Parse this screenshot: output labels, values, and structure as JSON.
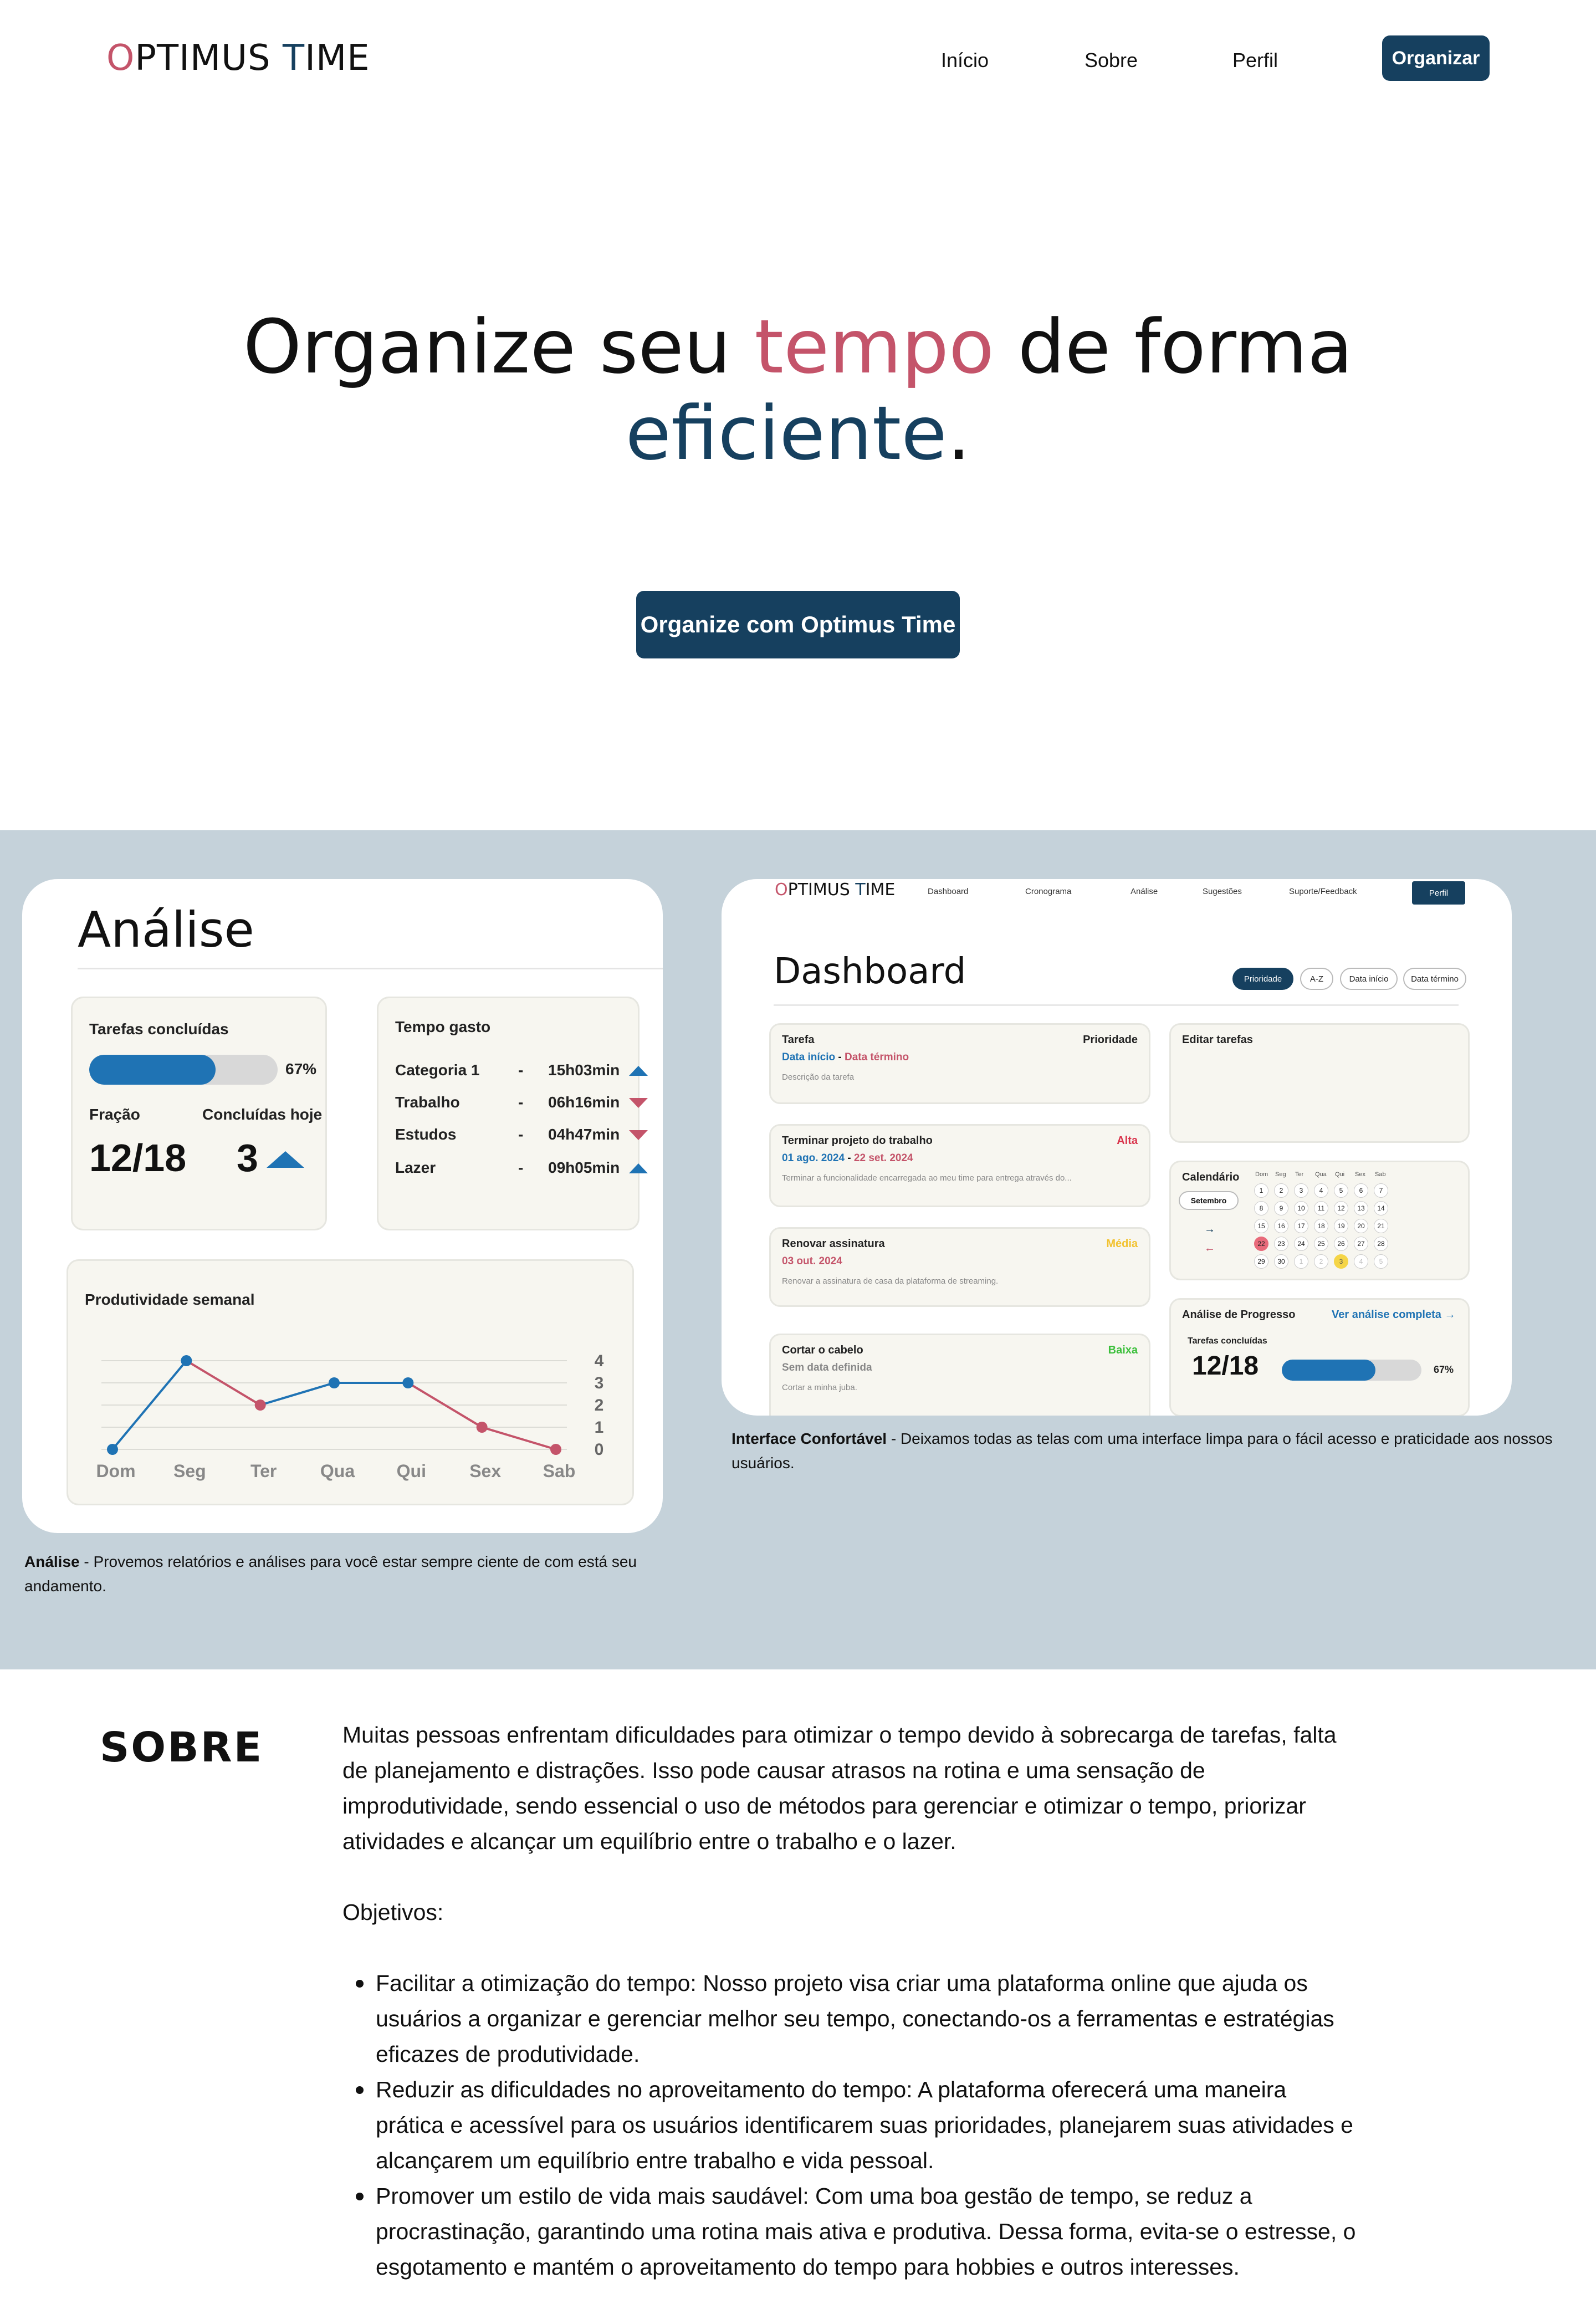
{
  "nav": {
    "logo_o": "O",
    "logo_ptimus": "PTIMUS ",
    "logo_t": "T",
    "logo_ime": "IME",
    "links": [
      "Início",
      "Sobre",
      "Perfil"
    ],
    "cta": "Organizar"
  },
  "hero": {
    "title_1": "Organize seu ",
    "title_pink": "tempo",
    "title_2": " de forma",
    "title_navy": "eficiente",
    "title_dot": ".",
    "cta": "Organize com Optimus Time"
  },
  "analysis": {
    "title": "Análise",
    "tasks_title": "Tarefas concluídas",
    "progress_label": "67%",
    "progress_value": 0.67,
    "fraction_label": "Fração",
    "fraction_value": "12/18",
    "done_today_label": "Concluídas hoje",
    "done_today_value": "3",
    "time_title": "Tempo gasto",
    "time_rows": [
      {
        "category": "Categoria 1",
        "dash": "-",
        "value": "15h03min",
        "trend": "up"
      },
      {
        "category": "Trabalho",
        "dash": "-",
        "value": "06h16min",
        "trend": "down"
      },
      {
        "category": "Estudos",
        "dash": "-",
        "value": "04h47min",
        "trend": "down"
      },
      {
        "category": "Lazer",
        "dash": "-",
        "value": "09h05min",
        "trend": "up"
      }
    ],
    "caption_bold": "Análise",
    "caption_text": " - Provemos relatórios e análises para você estar sempre ciente de com está seu andamento."
  },
  "chart_data": {
    "type": "line",
    "title": "Produtividade semanal",
    "categories": [
      "Dom",
      "Seg",
      "Ter",
      "Qua",
      "Qui",
      "Sex",
      "Sab"
    ],
    "values": [
      0,
      4,
      2,
      3,
      3,
      1,
      0
    ],
    "yticks": [
      "4",
      "3",
      "2",
      "1",
      "0"
    ],
    "ylim": [
      0,
      4
    ],
    "colors": {
      "rise": "#1f73b4",
      "fall": "#c4546a"
    },
    "grid": true
  },
  "dashboard": {
    "logo_o": "O",
    "logo_ptimus": "PTIMUS ",
    "logo_t": "T",
    "logo_ime": "IME",
    "nav": [
      "Dashboard",
      "Cronograma",
      "Análise",
      "Sugestões",
      "Suporte/Feedback"
    ],
    "perfil": "Perfil",
    "title": "Dashboard",
    "filters": [
      "Prioridade",
      "A-Z",
      "Data início",
      "Data término"
    ],
    "tasks": [
      {
        "title": "Tarefa",
        "priority": "Prioridade",
        "date_start": "Data início",
        "sep": " - ",
        "date_end": "Data término",
        "desc": "Descrição da tarefa"
      },
      {
        "title": "Terminar projeto do trabalho",
        "priority": "Alta",
        "date_start": "01 ago. 2024",
        "sep": " - ",
        "date_end": "22 set. 2024",
        "desc": "Terminar a funcionalidade encarregada ao meu time para entrega através do..."
      },
      {
        "title": "Renovar assinatura",
        "priority": "Média",
        "date_start": "03 out. 2024",
        "sep": "",
        "date_end": "",
        "desc": "Renovar a assinatura de casa da plataforma de streaming."
      },
      {
        "title": "Cortar o cabelo",
        "priority": "Baixa",
        "date_start": "Sem data definida",
        "sep": "",
        "date_end": "",
        "desc": "Cortar a minha juba."
      }
    ],
    "edit_tasks": "Editar tarefas",
    "calendar_title": "Calendário",
    "calendar_month": "Setembro",
    "calendar_weekdays": [
      "Dom",
      "Seg",
      "Ter",
      "Qua",
      "Qui",
      "Sex",
      "Sab"
    ],
    "calendar_days": [
      "1",
      "2",
      "3",
      "4",
      "5",
      "6",
      "7",
      "8",
      "9",
      "10",
      "11",
      "12",
      "13",
      "14",
      "15",
      "16",
      "17",
      "18",
      "19",
      "20",
      "21",
      "22",
      "23",
      "24",
      "25",
      "26",
      "27",
      "28",
      "29",
      "30",
      "1",
      "2",
      "3",
      "4",
      "5"
    ],
    "calendar_prev": "→",
    "calendar_next": "←",
    "progress_title": "Análise de Progresso",
    "progress_link": "Ver análise completa →",
    "progress_sub": "Tarefas concluídas",
    "progress_fraction": "12/18",
    "progress_pct": "67%",
    "progress_value": 0.67,
    "caption_bold": "Interface Confortável",
    "caption_text": " - Deixamos todas as telas com uma interface limpa para o fácil acesso e praticidade aos nossos usuários."
  },
  "sobre": {
    "heading": "SOBRE",
    "intro": "Muitas pessoas enfrentam dificuldades para otimizar o tempo devido à sobrecarga de tarefas, falta de planejamento e distrações. Isso pode causar atrasos na rotina e uma sensação de improdutividade, sendo essencial o uso de métodos para gerenciar e otimizar o tempo, priorizar atividades e alcançar um equilíbrio entre o trabalho e o lazer.",
    "objectives_label": "Objetivos:",
    "objectives": [
      "Facilitar a otimização do tempo: Nosso projeto visa criar uma plataforma online que ajuda os usuários a  organizar e gerenciar melhor seu tempo, conectando-os a ferramentas e estratégias eficazes de produtividade.",
      "Reduzir as dificuldades no aproveitamento do tempo: A plataforma oferecerá uma maneira prática e acessível para os usuários  identificarem suas prioridades, planejarem suas atividades e alcançarem  um equilíbrio entre trabalho e vida pessoal.",
      "Promover um estilo de vida mais saudável: Com uma boa gestão de tempo, se reduz a procrastinação, garantindo uma rotina mais ativa e produtiva. Dessa forma, evita-se o estresse, o esgotamento e mantém o aproveitamento do tempo para hobbies e outros interesses."
    ]
  }
}
